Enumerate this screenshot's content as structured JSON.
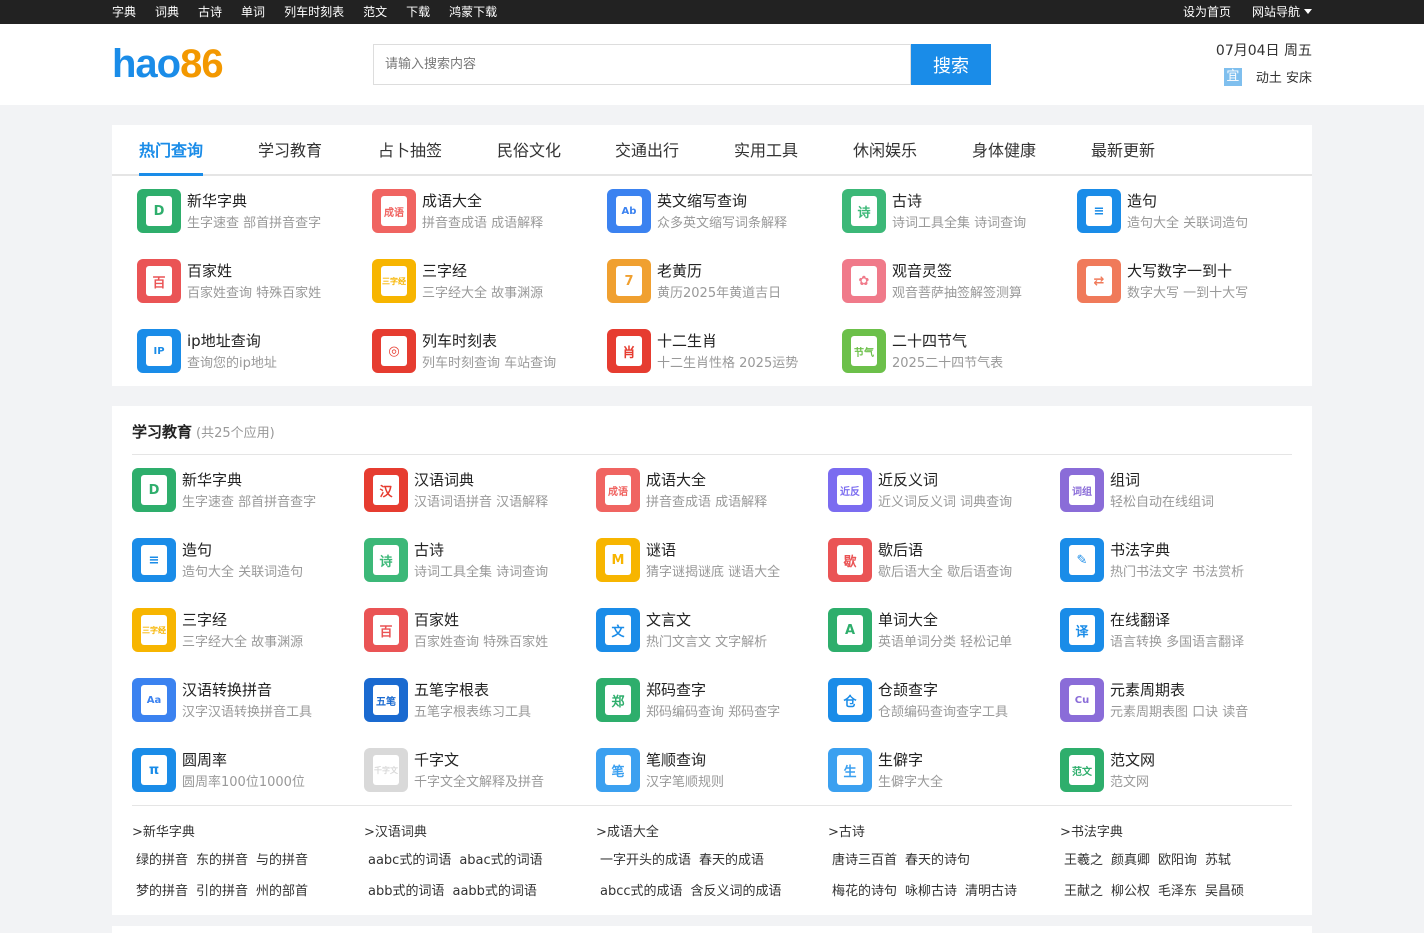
{
  "topnav": {
    "links": [
      "字典",
      "词典",
      "古诗",
      "单词",
      "列车时刻表",
      "范文",
      "下载",
      "鸿蒙下载"
    ],
    "right": [
      "设为首页",
      "网站导航"
    ]
  },
  "header": {
    "logo_a": "hao",
    "logo_b": "86",
    "search_placeholder": "请输入搜索内容",
    "search_button": "搜索",
    "date": "07月04日 周五",
    "weather_badge": "宜",
    "weather_text": "动土 安床"
  },
  "hot": {
    "tabs": [
      "热门查询",
      "学习教育",
      "占卜抽签",
      "民俗文化",
      "交通出行",
      "实用工具",
      "休闲娱乐",
      "身体健康",
      "最新更新"
    ],
    "items": [
      {
        "title": "新华字典",
        "desc": "生字速查 部首拼音查字",
        "color": "#2eae6c",
        "glyph": "D",
        "icon": "dictionary-icon"
      },
      {
        "title": "成语大全",
        "desc": "拼音查成语 成语解释",
        "color": "#f06461",
        "glyph": "成语",
        "icon": "idiom-book-icon"
      },
      {
        "title": "英文缩写查询",
        "desc": "众多英文缩写词条解释",
        "color": "#3b82f0",
        "glyph": "Ab",
        "icon": "abbreviation-icon"
      },
      {
        "title": "古诗",
        "desc": "诗词工具全集 诗词查询",
        "color": "#3cb878",
        "glyph": "诗",
        "icon": "poem-icon"
      },
      {
        "title": "造句",
        "desc": "造句大全 关联词造句",
        "color": "#1a8ce8",
        "glyph": "≡",
        "icon": "sentence-icon"
      },
      {
        "title": "百家姓",
        "desc": "百家姓查询 特殊百家姓",
        "color": "#ea5455",
        "glyph": "百",
        "icon": "surname-icon"
      },
      {
        "title": "三字经",
        "desc": "三字经大全 故事渊源",
        "color": "#f7b500",
        "glyph": "三字经",
        "icon": "three-char-classic-icon"
      },
      {
        "title": "老黄历",
        "desc": "黄历2025年黄道吉日",
        "color": "#f0a030",
        "glyph": "7",
        "icon": "calendar-icon"
      },
      {
        "title": "观音灵签",
        "desc": "观音菩萨抽签解签测算",
        "color": "#f07a8a",
        "glyph": "✿",
        "icon": "lotus-icon"
      },
      {
        "title": "大写数字一到十",
        "desc": "数字大写 一到十大写",
        "color": "#f07a5a",
        "glyph": "⇄",
        "icon": "number-convert-icon"
      },
      {
        "title": "ip地址查询",
        "desc": "查询您的ip地址",
        "color": "#1a8ce8",
        "glyph": "IP",
        "icon": "ip-icon"
      },
      {
        "title": "列车时刻表",
        "desc": "列车时刻查询 车站查询",
        "color": "#e63c30",
        "glyph": "◎",
        "icon": "train-icon"
      },
      {
        "title": "十二生肖",
        "desc": "十二生肖性格 2025运势",
        "color": "#e63c30",
        "glyph": "肖",
        "icon": "zodiac-icon"
      },
      {
        "title": "二十四节气",
        "desc": "2025二十四节气表",
        "color": "#6cc04a",
        "glyph": "节气",
        "icon": "solar-term-icon"
      }
    ]
  },
  "study": {
    "title": "学习教育",
    "count": "(共25个应用)",
    "items": [
      {
        "title": "新华字典",
        "desc": "生字速查 部首拼音查字",
        "color": "#2eae6c",
        "glyph": "D",
        "icon": "dictionary-icon"
      },
      {
        "title": "汉语词典",
        "desc": "汉语词语拼音 汉语解释",
        "color": "#e63c30",
        "glyph": "汉",
        "icon": "chinese-dictionary-icon"
      },
      {
        "title": "成语大全",
        "desc": "拼音查成语 成语解释",
        "color": "#f06461",
        "glyph": "成语",
        "icon": "idiom-book-icon"
      },
      {
        "title": "近反义词",
        "desc": "近义词反义词 词典查询",
        "color": "#7b6cf0",
        "glyph": "近反",
        "icon": "synonym-icon"
      },
      {
        "title": "组词",
        "desc": "轻松自动在线组词",
        "color": "#8a6cd8",
        "glyph": "词组",
        "icon": "word-group-icon"
      },
      {
        "title": "造句",
        "desc": "造句大全 关联词造句",
        "color": "#1a8ce8",
        "glyph": "≡",
        "icon": "sentence-icon"
      },
      {
        "title": "古诗",
        "desc": "诗词工具全集 诗词查询",
        "color": "#3cb878",
        "glyph": "诗",
        "icon": "poem-icon"
      },
      {
        "title": "谜语",
        "desc": "猜字谜揭谜底 谜语大全",
        "color": "#f7b500",
        "glyph": "M",
        "icon": "puzzle-icon"
      },
      {
        "title": "歇后语",
        "desc": "歇后语大全 歇后语查询",
        "color": "#ea5455",
        "glyph": "歇",
        "icon": "allegorical-saying-icon"
      },
      {
        "title": "书法字典",
        "desc": "热门书法文字 书法赏析",
        "color": "#1a8ce8",
        "glyph": "✎",
        "icon": "brush-icon"
      },
      {
        "title": "三字经",
        "desc": "三字经大全 故事渊源",
        "color": "#f7b500",
        "glyph": "三字经",
        "icon": "three-char-classic-icon"
      },
      {
        "title": "百家姓",
        "desc": "百家姓查询 特殊百家姓",
        "color": "#ea5455",
        "glyph": "百",
        "icon": "surname-icon"
      },
      {
        "title": "文言文",
        "desc": "热门文言文 文字解析",
        "color": "#1a8ce8",
        "glyph": "文",
        "icon": "classical-text-icon"
      },
      {
        "title": "单词大全",
        "desc": "英语单词分类 轻松记单",
        "color": "#2eae6c",
        "glyph": "A",
        "icon": "word-icon"
      },
      {
        "title": "在线翻译",
        "desc": "语言转换 多国语言翻译",
        "color": "#1a8ce8",
        "glyph": "译",
        "icon": "translate-icon"
      },
      {
        "title": "汉语转换拼音",
        "desc": "汉字汉语转换拼音工具",
        "color": "#3b82f0",
        "glyph": "Aa",
        "icon": "pinyin-icon"
      },
      {
        "title": "五笔字根表",
        "desc": "五笔字根表练习工具",
        "color": "#1a6ad0",
        "glyph": "五笔",
        "icon": "wubi-icon"
      },
      {
        "title": "郑码查字",
        "desc": "郑码编码查询 郑码查字",
        "color": "#2eae6c",
        "glyph": "郑",
        "icon": "zhengma-icon"
      },
      {
        "title": "仓颉查字",
        "desc": "仓颉编码查询查字工具",
        "color": "#1a8ce8",
        "glyph": "仓",
        "icon": "cangjie-icon"
      },
      {
        "title": "元素周期表",
        "desc": "元素周期表图 口诀 读音",
        "color": "#8a6cd8",
        "glyph": "Cu",
        "icon": "periodic-table-icon"
      },
      {
        "title": "圆周率",
        "desc": "圆周率100位1000位",
        "color": "#1a8ce8",
        "glyph": "π",
        "icon": "pi-icon"
      },
      {
        "title": "千字文",
        "desc": "千字文全文解释及拼音",
        "color": "#d9d9d9",
        "glyph": "千字文",
        "icon": "thousand-char-icon"
      },
      {
        "title": "笔顺查询",
        "desc": "汉字笔顺规则",
        "color": "#3ba0f0",
        "glyph": "笔",
        "icon": "stroke-order-icon"
      },
      {
        "title": "生僻字",
        "desc": "生僻字大全",
        "color": "#3ba0f0",
        "glyph": "生",
        "icon": "rare-char-icon"
      },
      {
        "title": "范文网",
        "desc": "范文网",
        "color": "#2eae6c",
        "glyph": "范文",
        "icon": "essay-icon"
      }
    ],
    "link_groups": [
      {
        "head": ">新华字典",
        "row1": [
          "绿的拼音",
          "东的拼音",
          "与的拼音"
        ],
        "row2": [
          "梦的拼音",
          "引的拼音",
          "州的部首"
        ]
      },
      {
        "head": ">汉语词典",
        "row1": [
          "aabc式的词语",
          "abac式的词语"
        ],
        "row2": [
          "abb式的词语",
          "aabb式的词语"
        ]
      },
      {
        "head": ">成语大全",
        "row1": [
          "一字开头的成语",
          "春天的成语"
        ],
        "row2": [
          "abcc式的成语",
          "含反义词的成语"
        ]
      },
      {
        "head": ">古诗",
        "row1": [
          "唐诗三百首",
          "春天的诗句"
        ],
        "row2": [
          "梅花的诗句",
          "咏柳古诗",
          "清明古诗"
        ]
      },
      {
        "head": ">书法字典",
        "row1": [
          "王羲之",
          "颜真卿",
          "欧阳询",
          "苏轼"
        ],
        "row2": [
          "王献之",
          "柳公权",
          "毛泽东",
          "吴昌硕"
        ]
      }
    ]
  }
}
